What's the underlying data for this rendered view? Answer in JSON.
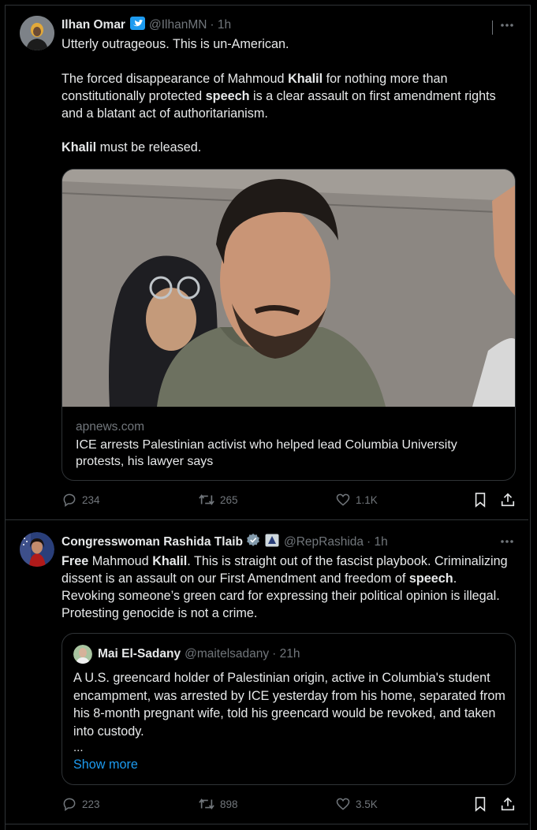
{
  "tweets": [
    {
      "author_name": "Ilhan Omar",
      "handle": "@IlhanMN",
      "time": "· 1h",
      "text_line1": "Utterly outrageous. This is un-American.",
      "p2_a": "The forced disappearance of Mahmoud ",
      "p2_b": "Khalil",
      "p2_c": " for nothing more than constitutionally protected ",
      "p2_d": "speech",
      "p2_e": " is a clear assault on first amendment rights and a blatant act of authoritarianism.",
      "p3_a": "Khalil",
      "p3_b": " must be released.",
      "card_domain": "apnews.com",
      "card_title": "ICE arrests Palestinian activist who helped lead Columbia University protests, his lawyer says",
      "replies": "234",
      "reposts": "265",
      "likes": "1.1K"
    },
    {
      "author_name": "Congresswoman Rashida Tlaib",
      "handle": "@RepRashida",
      "time": "· 1h",
      "t_a": "Free",
      "t_b": " Mahmoud ",
      "t_c": "Khalil",
      "t_d": ". This is straight out of the fascist playbook. Criminalizing dissent is an assault on our First Amendment and freedom of ",
      "t_e": "speech",
      "t_f": ". Revoking someone’s green card for expressing their political opinion is illegal. Protesting genocide is not a crime.",
      "quote": {
        "author_name": "Mai El-Sadany",
        "handle": "@maitelsadany",
        "time": "· 21h",
        "text": "A U.S. greencard holder of Palestinian origin, active in Columbia's student encampment, was arrested by ICE yesterday from his home, separated from his 8-month pregnant wife, told his greencard would be revoked, and taken into custody.",
        "ellipsis": "...",
        "show_more": "Show more"
      },
      "replies": "223",
      "reposts": "898",
      "likes": "3.5K"
    }
  ],
  "colors": {
    "background": "#000000",
    "text": "#e7e9ea",
    "muted": "#71767b",
    "link": "#1d9bf0",
    "verified": "#1d9bf0",
    "border": "#2f3336"
  },
  "icons": [
    "twitter-bird-icon",
    "verified-check-icon",
    "gov-label-icon",
    "more-icon",
    "reply-icon",
    "repost-icon",
    "like-icon",
    "bookmark-icon",
    "share-icon"
  ]
}
